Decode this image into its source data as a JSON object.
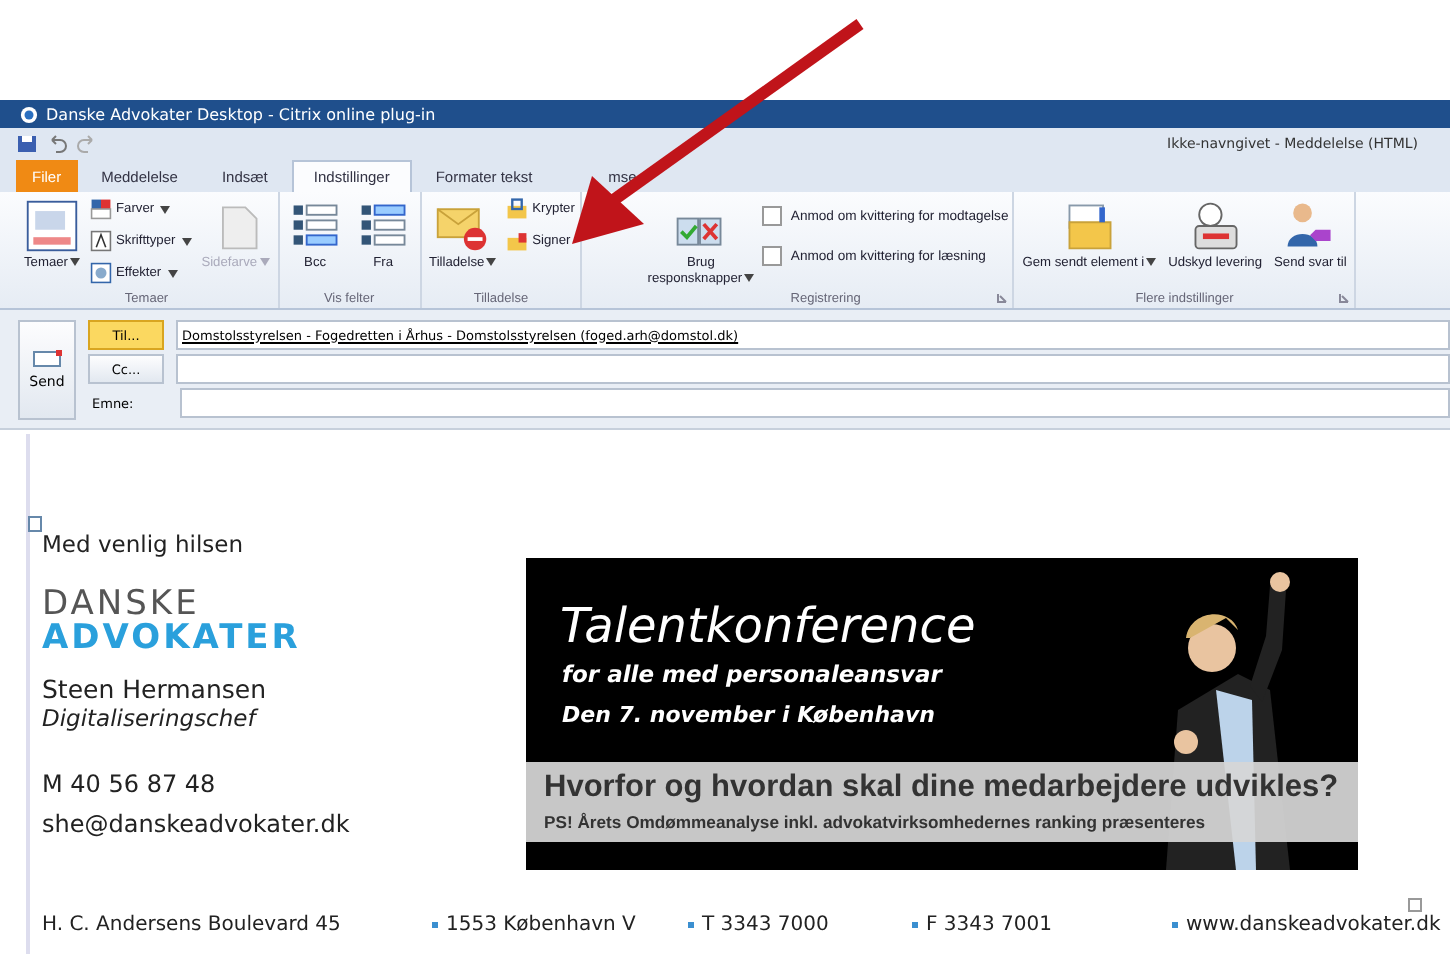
{
  "window": {
    "title": "Danske Advokater Desktop - Citrix online plug-in",
    "document_title": "Ikke-navngivet  -  Meddelelse (HTML)"
  },
  "tabs": [
    {
      "label": "Filer",
      "kind": "file",
      "selected": false
    },
    {
      "label": "Meddelelse",
      "kind": "tab",
      "selected": false
    },
    {
      "label": "Indsæt",
      "kind": "tab",
      "selected": false
    },
    {
      "label": "Indstillinger",
      "kind": "tab",
      "selected": true
    },
    {
      "label": "Formater tekst",
      "kind": "tab",
      "selected": false
    },
    {
      "label": "mse",
      "kind": "tab",
      "selected": false
    }
  ],
  "ribbon": [
    {
      "label": "Temaer",
      "launcher": false,
      "items": [
        {
          "kind": "large",
          "label": "Temaer",
          "dropdown": true,
          "disabled": false
        },
        {
          "kind": "stack",
          "items": [
            {
              "label": "Farver",
              "dropdown": true
            },
            {
              "label": "Skrifttyper",
              "dropdown": true
            },
            {
              "label": "Effekter",
              "dropdown": true
            }
          ]
        },
        {
          "kind": "large",
          "label": "Sidefarve",
          "dropdown": true,
          "disabled": true
        }
      ]
    },
    {
      "label": "Vis felter",
      "launcher": false,
      "items": [
        {
          "kind": "large",
          "label": "Bcc",
          "dropdown": false,
          "disabled": false
        },
        {
          "kind": "large",
          "label": "Fra",
          "dropdown": false,
          "disabled": false
        }
      ]
    },
    {
      "label": "Tilladelse",
      "launcher": false,
      "items": [
        {
          "kind": "large",
          "label": "Tilladelse",
          "dropdown": true,
          "disabled": false
        },
        {
          "kind": "stack",
          "items": [
            {
              "label": "Krypter",
              "dropdown": false
            },
            {
              "label": "Signer",
              "dropdown": false
            }
          ]
        }
      ]
    },
    {
      "label": "Registrering",
      "launcher": true,
      "items": [
        {
          "kind": "large",
          "label": "Brug responsknapper",
          "dropdown": true,
          "disabled": false
        },
        {
          "kind": "checks",
          "items": [
            {
              "label": "Anmod om kvittering for modtagelse",
              "checked": false
            },
            {
              "label": "Anmod om kvittering for læsning",
              "checked": false
            }
          ]
        }
      ]
    },
    {
      "label": "Flere indstillinger",
      "launcher": true,
      "items": [
        {
          "kind": "large",
          "label": "Gem sendt element i",
          "dropdown": true,
          "disabled": false
        },
        {
          "kind": "large",
          "label": "Udskyd levering",
          "dropdown": false,
          "disabled": false
        },
        {
          "kind": "large",
          "label": "Send svar til",
          "dropdown": false,
          "disabled": false
        }
      ]
    }
  ],
  "compose": {
    "send": "Send",
    "fields": [
      {
        "kind": "button",
        "label": "Til...",
        "selected": true,
        "value": "Domstolsstyrelsen - Fogedretten i Århus - Domstolsstyrelsen (foged.arh@domstol.dk)"
      },
      {
        "kind": "button",
        "label": "Cc...",
        "selected": false
      },
      {
        "kind": "label",
        "label": "Emne:"
      }
    ]
  },
  "body": {
    "greeting": "Med venlig hilsen",
    "logo": [
      "DANSKE",
      "ADVOKATER"
    ],
    "name": "Steen Hermansen",
    "role": "Digitaliseringschef",
    "phone": "M 40 56 87 48",
    "email": "she@danskeadvokater.dk",
    "banner": {
      "kind": "picture",
      "title": "Talentkonference",
      "subtitle": "for alle med personaleansvar",
      "date": "Den 7. november i København",
      "question": "Hvorfor og hvordan skal dine medarbejdere udvikles?",
      "note": "PS! Årets Omdømmeanalyse inkl. advokatvirksomhedernes ranking præsenteres"
    },
    "footer": [
      {
        "text": "H. C. Andersens Boulevard 45",
        "bullet": false
      },
      {
        "text": "1553 København V",
        "bullet": true
      },
      {
        "text": "T 3343 7000",
        "bullet": true
      },
      {
        "text": "F 3343 7001",
        "bullet": true
      },
      {
        "text": "www.danskeadvokater.dk",
        "bullet": true
      }
    ]
  }
}
